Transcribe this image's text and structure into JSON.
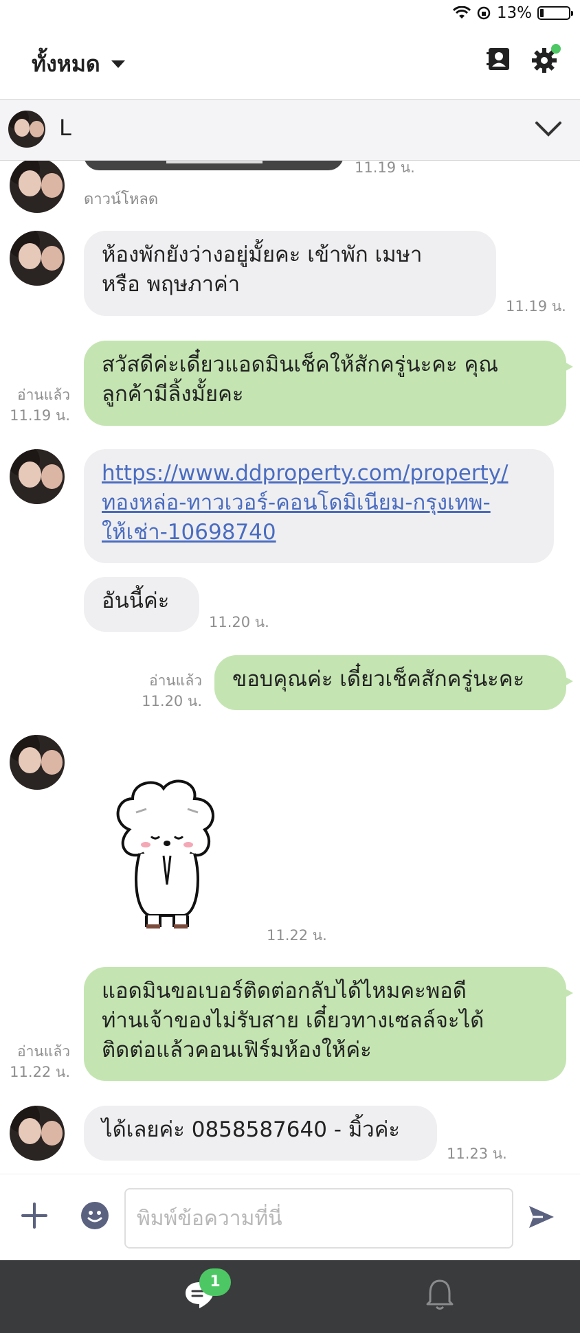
{
  "status": {
    "battery": "13%"
  },
  "header": {
    "title": "ทั้งหมด"
  },
  "chat": {
    "contact_name": "L"
  },
  "messages": {
    "partial_time": "11.19 น.",
    "download_label": "ดาวน์โหลด",
    "m1": {
      "line1": "ห้องพักยังว่างอยู่มั้ยคะ เข้าพัก เมษา",
      "line2": "หรือ พฤษภาค่า",
      "time": "11.19 น."
    },
    "m2": {
      "line1": "สวัสดีค่ะเดี๋ยวแอดมินเช็คให้สักครู่นะคะ คุณ",
      "line2": "ลูกค้ามีลิ้งมั้ยคะ",
      "read": "อ่านแล้ว",
      "time": "11.19 น."
    },
    "m3": {
      "line1": "https://www.ddproperty.com/property/",
      "line2": "ทองหล่อ-ทาวเวอร์-คอนโดมิเนียม-กรุงเทพ-",
      "line3": "ให้เช่า-10698740"
    },
    "m4": {
      "text": "อันนี้ค่ะ",
      "time": "11.20 น."
    },
    "m5": {
      "text": "ขอบคุณค่ะ เดี๋ยวเช็คสักครู่นะคะ",
      "read": "อ่านแล้ว",
      "time": "11.20 น."
    },
    "m6": {
      "time": "11.22 น."
    },
    "m7": {
      "line1": "แอดมินขอเบอร์ติดต่อกลับได้ไหมคะพอดี",
      "line2": "ท่านเจ้าของไม่รับสาย เดี๋ยวทางเซลล์จะได้",
      "line3": "ติดต่อแล้วคอนเฟิร์มห้องให้ค่ะ",
      "read": "อ่านแล้ว",
      "time": "11.22 น."
    },
    "m8": {
      "text": "ได้เลยค่ะ 0858587640 - มิ้วค่ะ",
      "time": "11.23 น."
    }
  },
  "input": {
    "placeholder": "พิมพ์ข้อความที่นี่"
  },
  "nav": {
    "chat_badge": "1"
  }
}
